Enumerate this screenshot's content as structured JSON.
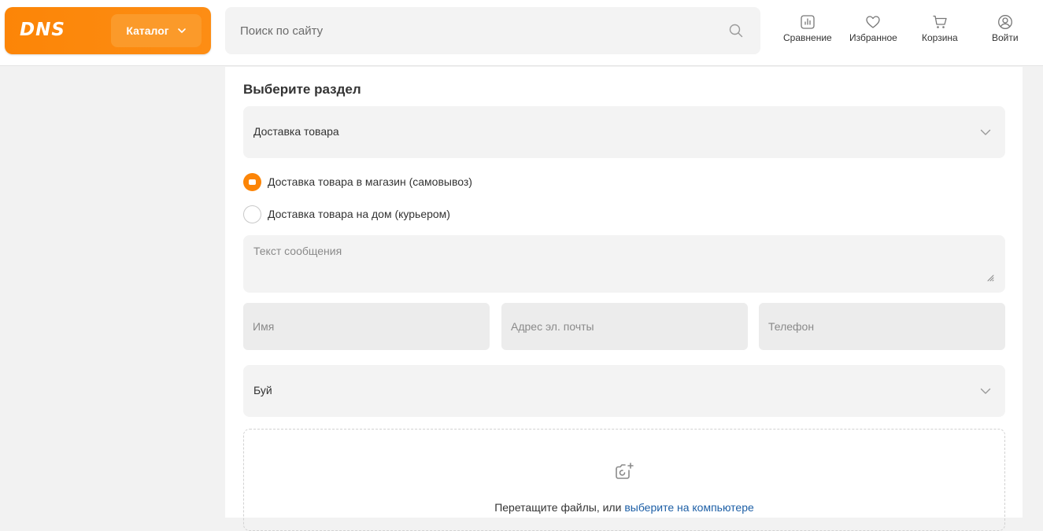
{
  "header": {
    "logo": "DNS",
    "catalog_label": "Каталог",
    "search_placeholder": "Поиск по сайту",
    "nav": {
      "compare": "Сравнение",
      "favorites": "Избранное",
      "cart": "Корзина",
      "login": "Войти"
    },
    "accent_color": "#fc8507"
  },
  "form": {
    "section_title": "Выберите раздел",
    "section_select_value": "Доставка товара",
    "radio_options": [
      {
        "label": "Доставка товара в магазин (самовывоз)",
        "checked": true
      },
      {
        "label": "Доставка товара на дом (курьером)",
        "checked": false
      }
    ],
    "message_placeholder": "Текст сообщения",
    "name_placeholder": "Имя",
    "email_placeholder": "Адрес эл. почты",
    "phone_placeholder": "Телефон",
    "city_select_value": "Буй",
    "dropzone": {
      "text": "Перетащите файлы, или",
      "link": "выберите на компьютере"
    }
  },
  "icons": [
    "chevron-down-icon",
    "search-icon",
    "compare-icon",
    "heart-icon",
    "cart-icon",
    "user-icon",
    "resize-grip-icon",
    "camera-add-icon"
  ]
}
